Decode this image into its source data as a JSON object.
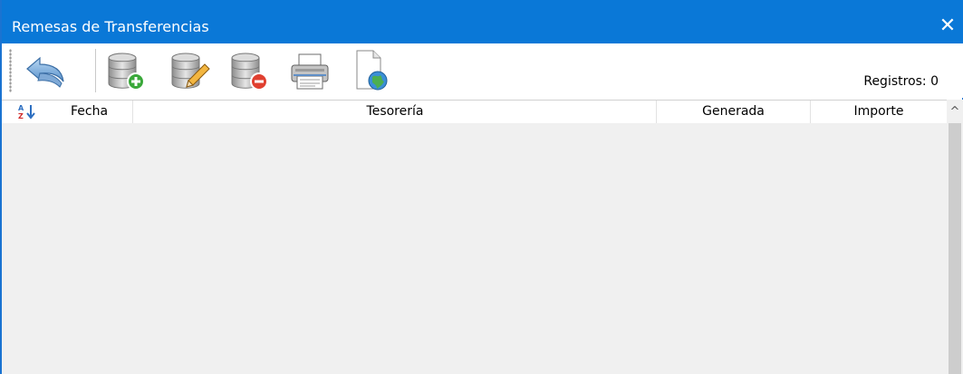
{
  "window": {
    "title": "Remesas de Transferencias",
    "close_glyph": "✕"
  },
  "toolbar": {
    "buttons": [
      {
        "name": "back",
        "icon": "undo-arrow-icon"
      },
      {
        "name": "add",
        "icon": "database-add-icon"
      },
      {
        "name": "edit",
        "icon": "database-edit-icon"
      },
      {
        "name": "delete",
        "icon": "database-delete-icon"
      },
      {
        "name": "print",
        "icon": "printer-icon"
      },
      {
        "name": "export",
        "icon": "document-globe-icon"
      }
    ],
    "records_label": "Registros: 0"
  },
  "grid": {
    "sort_icon": "sort-az-icon",
    "columns": [
      "Fecha",
      "Tesorería",
      "Generada",
      "Importe"
    ],
    "rows": []
  },
  "scrollbar": {
    "up_glyph": "^"
  },
  "colors": {
    "titlebar": "#0a78d7",
    "body": "#f0f0f0"
  }
}
